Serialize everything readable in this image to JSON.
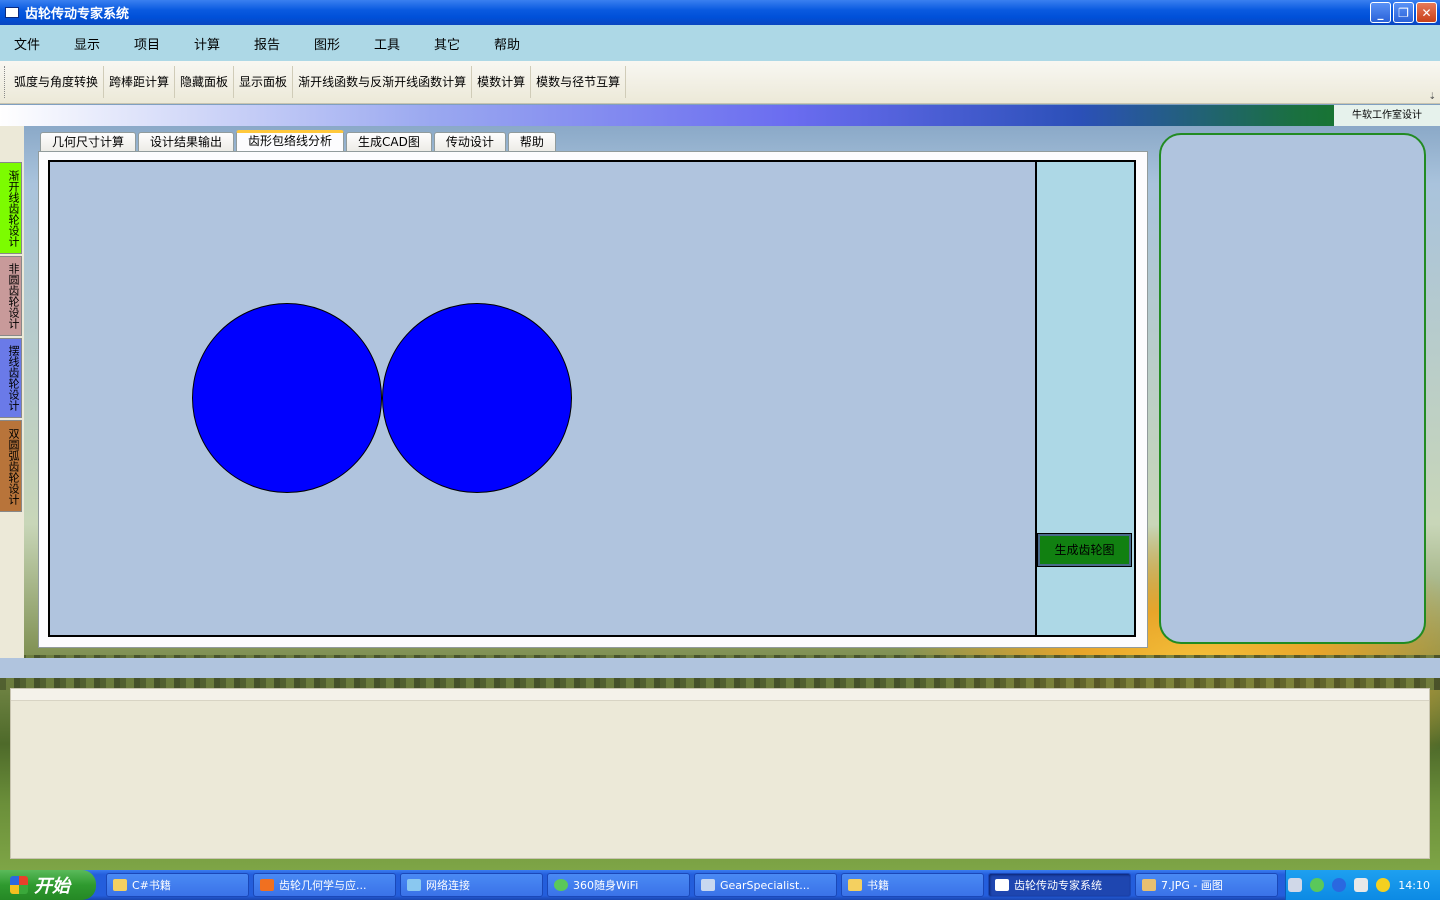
{
  "window": {
    "title": "齿轮传动专家系统"
  },
  "menu": [
    "文件",
    "显示",
    "项目",
    "计算",
    "报告",
    "图形",
    "工具",
    "其它",
    "帮助"
  ],
  "toolbar": [
    "弧度与角度转换",
    "跨棒距计算",
    "隐藏面板",
    "显示面板",
    "渐开线函数与反渐开线函数计算",
    "模数计算",
    "模数与径节互算"
  ],
  "credit": "牛软工作室设计",
  "left_tabs": [
    "渐开线齿轮设计",
    "非圆齿轮设计",
    "摆线齿轮设计",
    "双圆弧齿轮设计"
  ],
  "tabs": [
    "几何尺寸计算",
    "设计结果输出",
    "齿形包络线分析",
    "生成CAD图",
    "传动设计",
    "帮助"
  ],
  "active_tab": "齿形包络线分析",
  "generate_button": "生成齿轮图",
  "taskbar": {
    "start": "开始",
    "items": [
      "C#书籍",
      "齿轮几何学与应...",
      "网络连接",
      "360随身WiFi",
      "GearSpecialist...",
      "书籍",
      "齿轮传动专家系统",
      "7.JPG - 画图"
    ],
    "active": "齿轮传动专家系统",
    "clock": "14:10"
  },
  "colors": {
    "menubar": "#add8e6",
    "canvas": "#b0c4de",
    "gear_circle": "#0000ff",
    "generate_button": "#118011",
    "right_panel_border": "#228b22"
  }
}
